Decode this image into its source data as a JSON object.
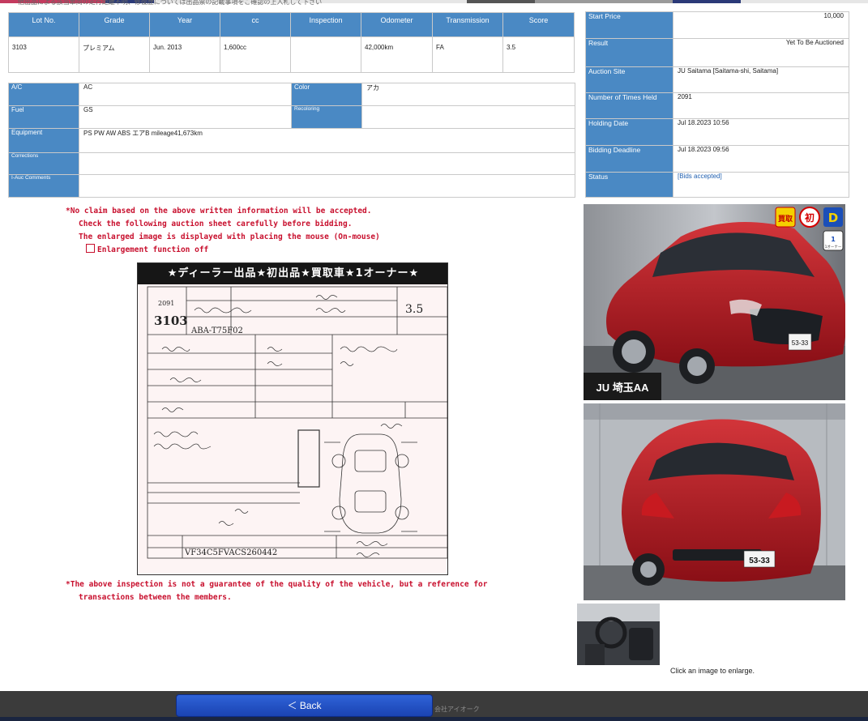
{
  "top_note": "他出品による該当車両の走行距離不明、修復歴については出品票の記載事項をご確認の上入札して下さい",
  "lot": {
    "headers": [
      "Lot No.",
      "Grade",
      "Year",
      "cc",
      "Inspection",
      "Odometer",
      "Transmission",
      "Score"
    ],
    "values": [
      "3103",
      "プレミアム",
      "Jun. 2013",
      "1,600cc",
      "",
      "42,000km",
      "FA",
      "3.5"
    ]
  },
  "details": {
    "ac_label": "A/C",
    "ac_value": "AC",
    "color_label": "Color",
    "color_value": "アカ",
    "fuel_label": "Fuel",
    "fuel_value": "GS",
    "recoloring_label": "Recoloring",
    "recoloring_value": "",
    "equipment_label": "Equipment",
    "equipment_value": "PS PW AW ABS エアB  mileage41,673km",
    "corrections_label": "Corrections",
    "corrections_value": "",
    "iauc_label": "I-Auc Comments",
    "iauc_value": ""
  },
  "auction": {
    "start_price_label": "Start Price",
    "start_price_value": "10,000",
    "result_label": "Result",
    "result_value": "Yet To Be Auctioned",
    "site_label": "Auction Site",
    "site_value": "JU Saitama [Saitama-shi, Saitama]",
    "times_label": "Number of Times Held",
    "times_value": "2091",
    "holding_label": "Holding Date",
    "holding_value": "Jul 18.2023 10:56",
    "deadline_label": "Bidding Deadline",
    "deadline_value": "Jul 18.2023 09:56",
    "status_label": "Status",
    "status_value": "[Bids accepted]",
    "status_color": "#1f5fb0"
  },
  "warnings": {
    "line1": "*No claim based on the above written information will be accepted.",
    "line2": "Check the following auction sheet carefully before bidding.",
    "line3": "The enlarged image is displayed with placing the mouse (On-mouse)",
    "enlargement_label": "Enlargement function off",
    "bottom1": "*The above inspection is not a guarantee of the quality of the vehicle, but a reference for",
    "bottom2": "transactions between the members."
  },
  "sheet": {
    "banner": "★ディーラー出品★初出品★買取車★1オーナー★",
    "lot_number": "3103",
    "session": "2091",
    "model_code": "ABA-T75F02",
    "score": "3.5",
    "chassis": "VF34C5FVACS260442"
  },
  "photos": {
    "badges": [
      "買取",
      "初",
      "D",
      "1オーナー"
    ],
    "watermark": "JU 埼玉AA",
    "plate": "53-33",
    "enlarge_note": "Click an image to enlarge."
  },
  "footer": {
    "back_label": "＜ Back",
    "company": "会社アイオーク"
  },
  "colors": {
    "header_blue": "#4a89c4",
    "warning_red": "#c8102e",
    "car_red": "#b3121c",
    "button_blue": "#2154c6"
  }
}
